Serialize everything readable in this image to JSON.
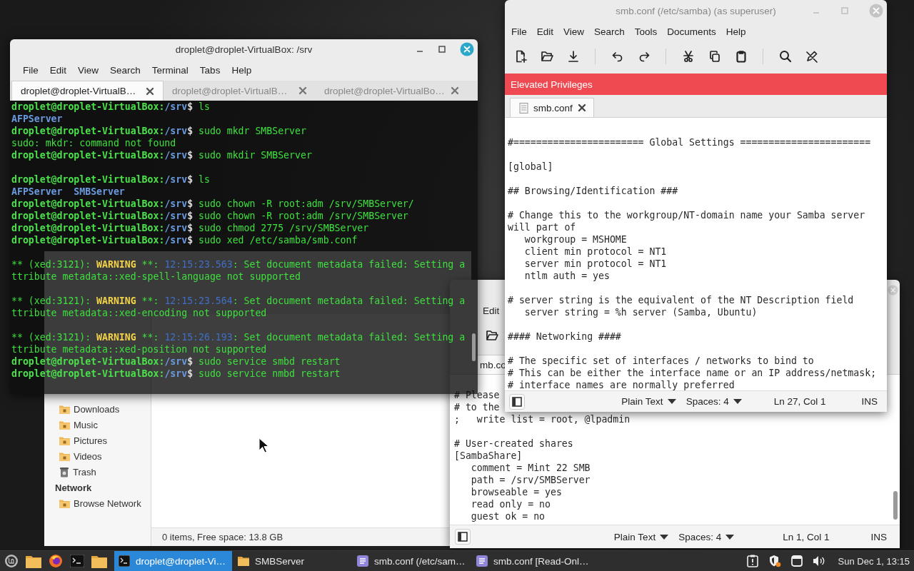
{
  "terminal": {
    "title": "droplet@droplet-VirtualBox: /srv",
    "menu": [
      "File",
      "Edit",
      "View",
      "Search",
      "Terminal",
      "Tabs",
      "Help"
    ],
    "tabs": [
      {
        "label": "droplet@droplet-VirtualB…",
        "selected": true
      },
      {
        "label": "droplet@droplet-VirtualB…",
        "selected": false
      },
      {
        "label": "droplet@droplet-VirtualBo…",
        "selected": false
      }
    ],
    "lines": [
      {
        "kind": "prompt",
        "host": "droplet@droplet-VirtualBox:",
        "path": "/srv",
        "sign": "$",
        "command": "ls"
      },
      {
        "kind": "dirs",
        "items": [
          "AFPServer"
        ]
      },
      {
        "kind": "prompt",
        "host": "droplet@droplet-VirtualBox:",
        "path": "/srv",
        "sign": "$",
        "command": "sudo mkdr SMBServer"
      },
      {
        "kind": "output",
        "text": "sudo: mkdr: command not found"
      },
      {
        "kind": "prompt",
        "host": "droplet@droplet-VirtualBox:",
        "path": "/srv",
        "sign": "$",
        "command": "sudo mkdir SMBServer"
      },
      {
        "kind": "blank"
      },
      {
        "kind": "prompt",
        "host": "droplet@droplet-VirtualBox:",
        "path": "/srv",
        "sign": "$",
        "command": "ls"
      },
      {
        "kind": "dirs",
        "items": [
          "AFPServer",
          "SMBServer"
        ]
      },
      {
        "kind": "prompt",
        "host": "droplet@droplet-VirtualBox:",
        "path": "/srv",
        "sign": "$",
        "command": "sudo chown -R root:adm /srv/SMBServer/"
      },
      {
        "kind": "prompt",
        "host": "droplet@droplet-VirtualBox:",
        "path": "/srv",
        "sign": "$",
        "command": "sudo chown -R root:adm /srv/SMBServer"
      },
      {
        "kind": "prompt",
        "host": "droplet@droplet-VirtualBox:",
        "path": "/srv",
        "sign": "$",
        "command": "sudo chmod 2775 /srv/SMBServer"
      },
      {
        "kind": "prompt",
        "host": "droplet@droplet-VirtualBox:",
        "path": "/srv",
        "sign": "$",
        "command": "sudo xed /etc/samba/smb.conf"
      },
      {
        "kind": "blank"
      },
      {
        "kind": "warning",
        "prefix": "** (xed:3121):",
        "level": "WARNING",
        "sep": "**:",
        "time": "12:15:23.563",
        "message": ": Set document metadata failed: Setting a"
      },
      {
        "kind": "output",
        "text": "ttribute metadata::xed-spell-language not supported"
      },
      {
        "kind": "blank"
      },
      {
        "kind": "warning",
        "prefix": "** (xed:3121):",
        "level": "WARNING",
        "sep": "**:",
        "time": "12:15:23.564",
        "message": ": Set document metadata failed: Setting a"
      },
      {
        "kind": "output",
        "text": "ttribute metadata::xed-encoding not supported"
      },
      {
        "kind": "blank"
      },
      {
        "kind": "warning",
        "prefix": "** (xed:3121):",
        "level": "WARNING",
        "sep": "**:",
        "time": "12:15:26.193",
        "message": ": Set document metadata failed: Setting a"
      },
      {
        "kind": "output",
        "text": "ttribute metadata::xed-position not supported"
      },
      {
        "kind": "prompt",
        "host": "droplet@droplet-VirtualBox:",
        "path": "/srv",
        "sign": "$",
        "command": "sudo service smbd restart"
      },
      {
        "kind": "prompt",
        "host": "droplet@droplet-VirtualBox:",
        "path": "/srv",
        "sign": "$",
        "command": "sudo service nmbd restart"
      }
    ]
  },
  "file_manager": {
    "sidebar": [
      {
        "kind": "folder",
        "label": "Downloads"
      },
      {
        "kind": "folder",
        "label": "Music"
      },
      {
        "kind": "folder",
        "label": "Pictures"
      },
      {
        "kind": "folder",
        "label": "Videos"
      },
      {
        "kind": "trash",
        "label": "Trash"
      },
      {
        "kind": "heading",
        "label": "Network"
      },
      {
        "kind": "folder",
        "label": "Browse Network"
      }
    ],
    "status": "0 items, Free space: 13.8 GB"
  },
  "editor_back": {
    "menu": [
      "Edit"
    ],
    "toolbar": true,
    "tab": "mb.co",
    "lines": [
      {
        "kind": "code",
        "text": "# Please"
      },
      {
        "kind": "code",
        "text": "# to the"
      },
      {
        "kind": "code",
        "text": ";   write list = root, @lpadmin"
      },
      {
        "kind": "blank"
      },
      {
        "kind": "code",
        "text": "# User-created shares"
      },
      {
        "kind": "code",
        "text": "[SambaShare]"
      },
      {
        "kind": "code",
        "text": "   comment = Mint 22 SMB"
      },
      {
        "kind": "code",
        "text": "   path = /srv/SMBServer"
      },
      {
        "kind": "code",
        "text": "   browseable = yes"
      },
      {
        "kind": "code",
        "text": "   read only = no"
      },
      {
        "kind": "code",
        "text": "   guest ok = no"
      }
    ],
    "status": {
      "language": "Plain Text",
      "indent": "Spaces: 4",
      "position": "Ln 1, Col 1",
      "mode": "INS"
    }
  },
  "editor_front": {
    "title": "smb.conf (/etc/samba) (as superuser)",
    "menu": [
      "File",
      "Edit",
      "View",
      "Search",
      "Tools",
      "Documents",
      "Help"
    ],
    "toolbar": true,
    "banner": "Elevated Privileges",
    "tab": "smb.conf",
    "lines": [
      {
        "kind": "code",
        "text": "#======================= Global Settings ======================="
      },
      {
        "kind": "blank"
      },
      {
        "kind": "code",
        "text": "[global]"
      },
      {
        "kind": "blank"
      },
      {
        "kind": "code",
        "text": "## Browsing/Identification ###"
      },
      {
        "kind": "blank"
      },
      {
        "kind": "code",
        "text": "# Change this to the workgroup/NT-domain name your Samba server"
      },
      {
        "kind": "code",
        "text": "will part of"
      },
      {
        "kind": "code",
        "text": "   workgroup = MSHOME"
      },
      {
        "kind": "code",
        "text": "   client min protocol = NT1"
      },
      {
        "kind": "code",
        "text": "   server min protocol = NT1"
      },
      {
        "kind": "code",
        "text": "   ntlm auth = yes"
      },
      {
        "kind": "blank"
      },
      {
        "kind": "code",
        "text": "# server string is the equivalent of the NT Description field"
      },
      {
        "kind": "code",
        "text": "   server string = %h server (Samba, Ubuntu)"
      },
      {
        "kind": "blank"
      },
      {
        "kind": "code",
        "text": "#### Networking ####"
      },
      {
        "kind": "blank"
      },
      {
        "kind": "code",
        "text": "# The specific set of interfaces / networks to bind to"
      },
      {
        "kind": "code",
        "text": "# This can be either the interface name or an IP address/netmask;"
      },
      {
        "kind": "code",
        "text": "# interface names are normally preferred"
      }
    ],
    "status": {
      "language": "Plain Text",
      "indent": "Spaces: 4",
      "position": "Ln 27, Col 1",
      "mode": "INS"
    }
  },
  "taskbar": {
    "tasks": [
      {
        "kind": "terminal",
        "label": "droplet@droplet-Vi…",
        "selected": true
      },
      {
        "kind": "folder",
        "label": "SMBServer",
        "selected": false
      },
      {
        "kind": "editor",
        "label": "smb.conf (/etc/sam…",
        "selected": false
      },
      {
        "kind": "editor",
        "label": "smb.conf [Read-Onl…",
        "selected": false
      }
    ],
    "clock": "Sun Dec 1, 13:15"
  }
}
